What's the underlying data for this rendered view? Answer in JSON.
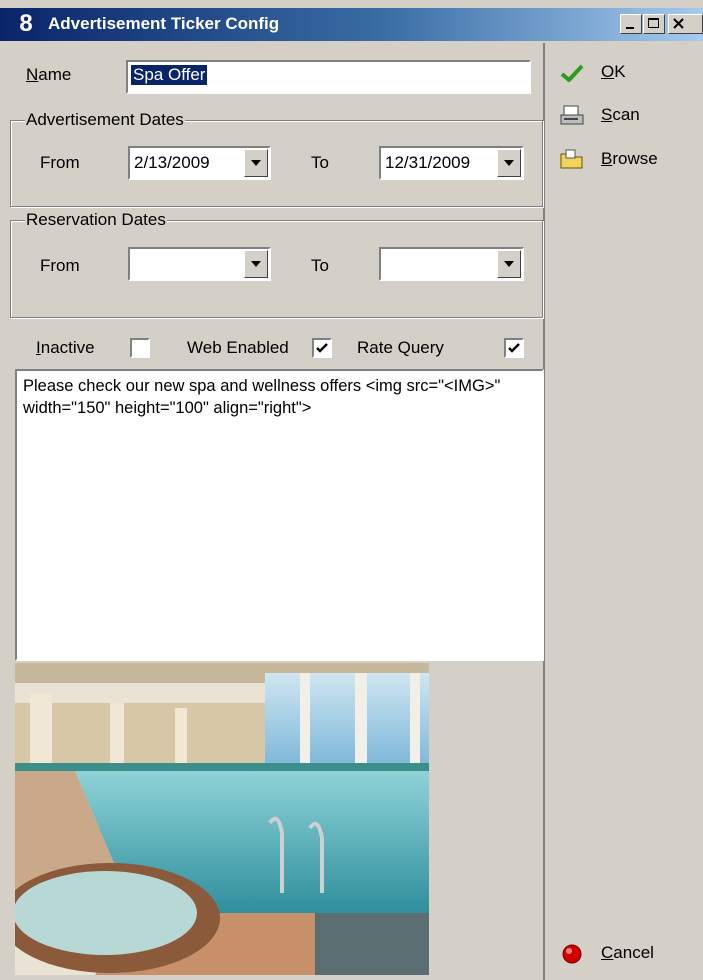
{
  "window": {
    "app_icon": "8",
    "title": "Advertisement Ticker Config",
    "minimize_icon": "minimize-icon",
    "maximize_icon": "maximize-icon",
    "close_icon": "close-icon"
  },
  "name": {
    "label": "Name",
    "value": "Spa Offer"
  },
  "advertisement_dates": {
    "title": "Advertisement Dates",
    "from_label": "From",
    "from_value": "2/13/2009",
    "to_label": "To",
    "to_value": "12/31/2009"
  },
  "reservation_dates": {
    "title": "Reservation Dates",
    "from_label": "From",
    "from_value": "",
    "to_label": "To",
    "to_value": ""
  },
  "flags": {
    "inactive_label": "Inactive",
    "inactive_checked": false,
    "web_enabled_label": "Web Enabled",
    "web_enabled_checked": true,
    "rate_query_label": "Rate Query",
    "rate_query_checked": true
  },
  "memo": {
    "text": "Please check our new spa and wellness offers <img src=\"<IMG>\" width=\"150\" height=\"100\" align=\"right\">"
  },
  "actions": {
    "ok_label": "OK",
    "scan_label": "Scan",
    "browse_label": "Browse",
    "cancel_label": "Cancel"
  },
  "colors": {
    "selection": "#0a246a",
    "ok_check": "#2e9a1e",
    "cancel_red": "#d00000",
    "face": "#d4d0c8"
  }
}
